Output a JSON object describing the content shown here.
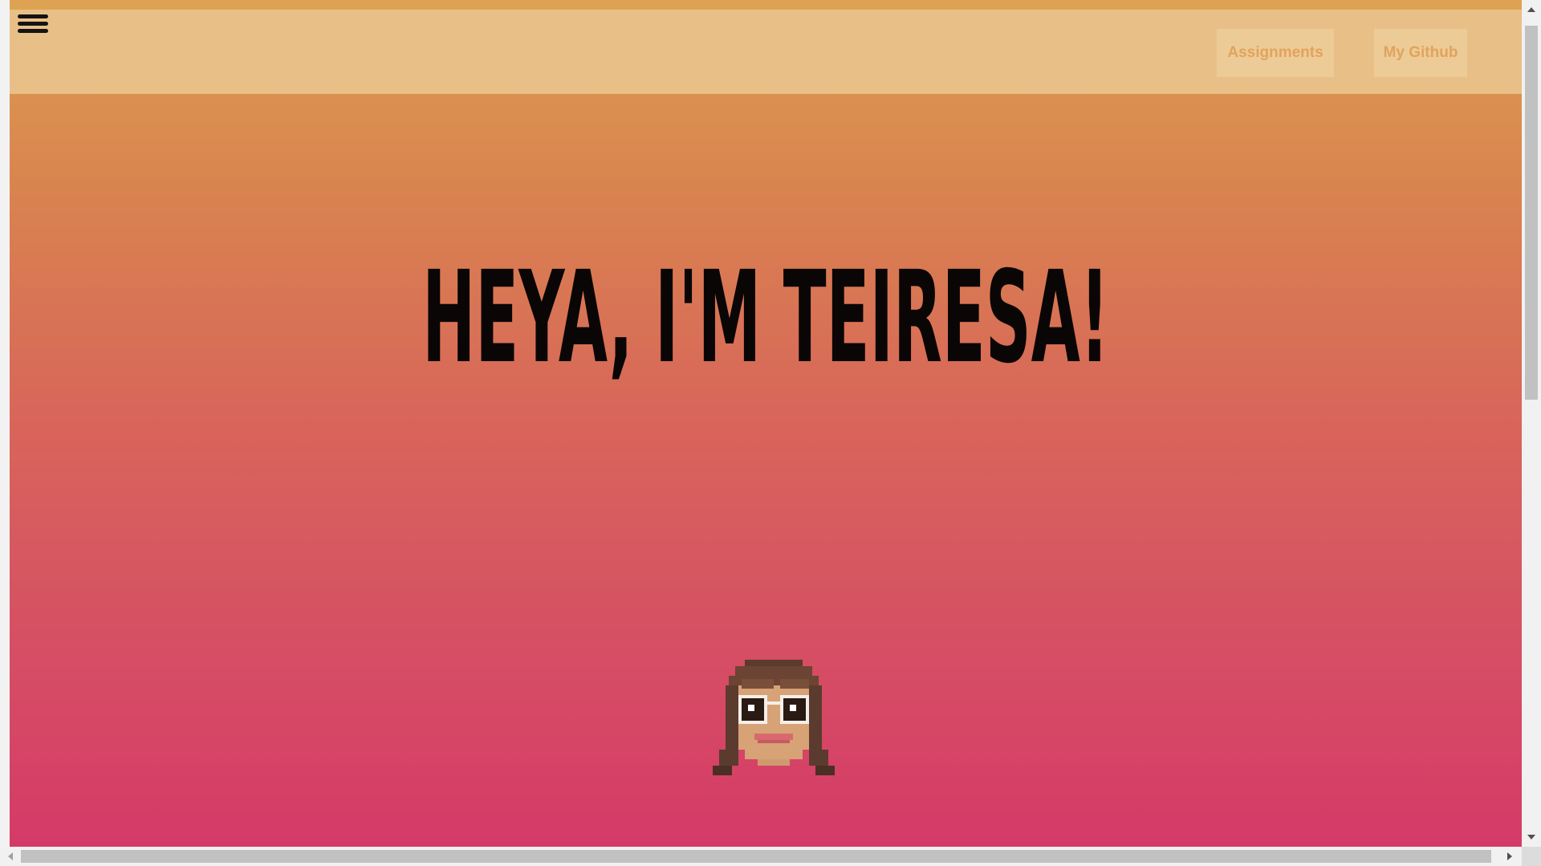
{
  "nav": {
    "menu_icon": "hamburger-menu-icon",
    "links": [
      {
        "label": "Assignments"
      },
      {
        "label": "My Github"
      }
    ]
  },
  "hero": {
    "title": "HEYA, I'M TEIRESA!",
    "avatar": "pixel-art-girl-face"
  },
  "colors": {
    "gradient_top": "#dc9e52",
    "gradient_bottom": "#d53a67",
    "navbar": "#e8c087",
    "button_bg": "#edcb96",
    "button_text": "#e2a35c",
    "title_text": "#0b0606"
  }
}
